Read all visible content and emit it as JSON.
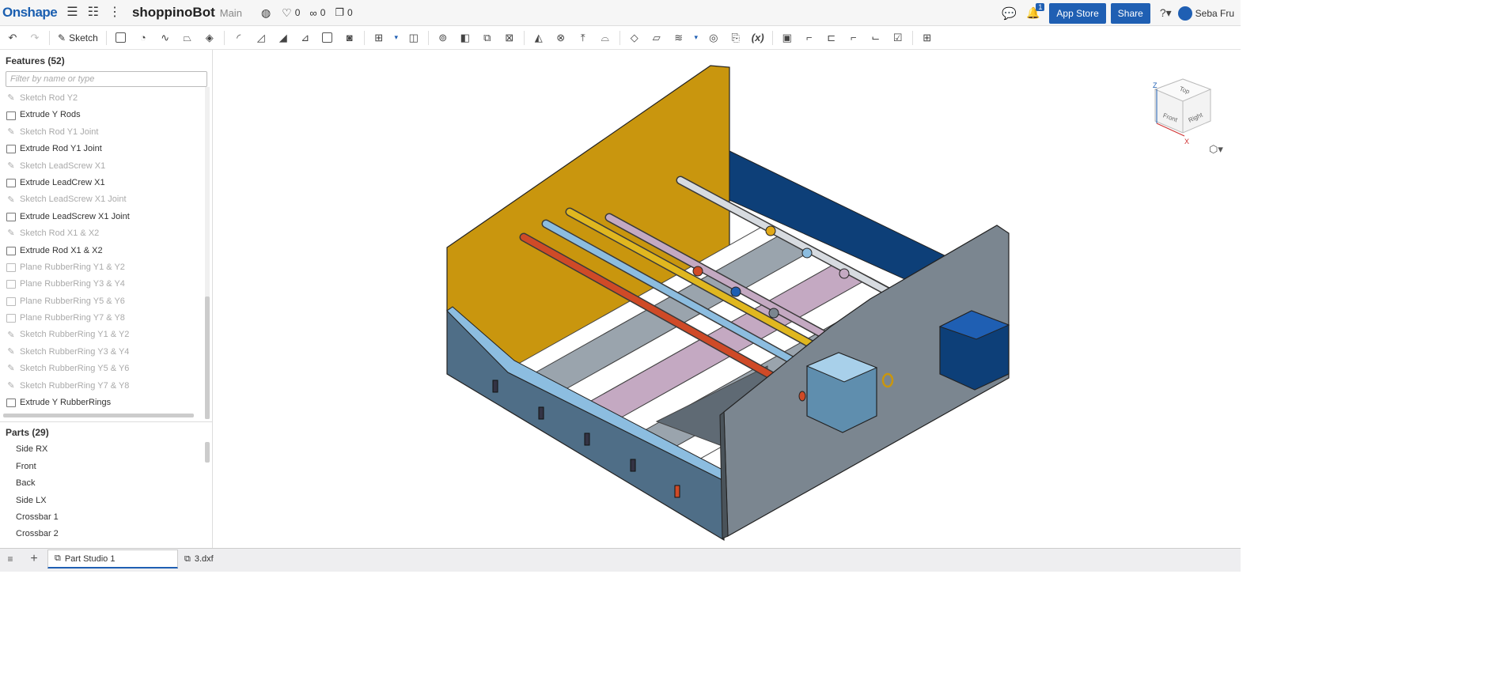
{
  "header": {
    "logo": "Onshape",
    "doc_name": "shoppinoBot",
    "branch": "Main",
    "likes": "0",
    "links": "0",
    "copies": "0",
    "notifications": "1",
    "app_store": "App Store",
    "share": "Share",
    "user": "Seba Fru"
  },
  "toolbar": {
    "sketch_label": "Sketch"
  },
  "features": {
    "title": "Features (52)",
    "filter_placeholder": "Filter by name or type",
    "items": [
      {
        "label": "Sketch Rod Y2",
        "type": "sketch"
      },
      {
        "label": "Extrude Y Rods",
        "type": "extrude"
      },
      {
        "label": "Sketch Rod Y1 Joint",
        "type": "sketch"
      },
      {
        "label": "Extrude Rod Y1 Joint",
        "type": "extrude"
      },
      {
        "label": "Sketch LeadScrew X1",
        "type": "sketch"
      },
      {
        "label": "Extrude LeadCrew X1",
        "type": "extrude"
      },
      {
        "label": "Sketch LeadScrew X1 Joint",
        "type": "sketch"
      },
      {
        "label": "Extrude LeadScrew X1 Joint",
        "type": "extrude"
      },
      {
        "label": "Sketch Rod X1 & X2",
        "type": "sketch"
      },
      {
        "label": "Extrude Rod X1 & X2",
        "type": "extrude"
      },
      {
        "label": "Plane RubberRing Y1 & Y2",
        "type": "plane"
      },
      {
        "label": "Plane RubberRing Y3 & Y4",
        "type": "plane"
      },
      {
        "label": "Plane RubberRing Y5 & Y6",
        "type": "plane"
      },
      {
        "label": "Plane RubberRing Y7 & Y8",
        "type": "plane"
      },
      {
        "label": "Sketch RubberRing Y1 & Y2",
        "type": "sketch"
      },
      {
        "label": "Sketch RubberRing Y3 & Y4",
        "type": "sketch"
      },
      {
        "label": "Sketch RubberRing Y5 & Y6",
        "type": "sketch"
      },
      {
        "label": "Sketch RubberRing Y7 & Y8",
        "type": "sketch"
      },
      {
        "label": "Extrude Y RubberRings",
        "type": "extrude"
      }
    ]
  },
  "parts": {
    "title": "Parts (29)",
    "items": [
      "Side RX",
      "Front",
      "Back",
      "Side LX",
      "Crossbar 1",
      "Crossbar 2"
    ]
  },
  "tabs": [
    {
      "label": "Part Studio 1",
      "active": true
    },
    {
      "label": "3.dxf",
      "active": false
    }
  ],
  "viewcube": {
    "top": "Top",
    "front": "Front",
    "right": "Right",
    "x": "X",
    "z": "Z"
  },
  "colors": {
    "accent": "#1f5fb3",
    "yellow": "#c9960e",
    "blue": "#0d3f78",
    "gray": "#7b8690",
    "lightblue": "#6e97b5"
  }
}
